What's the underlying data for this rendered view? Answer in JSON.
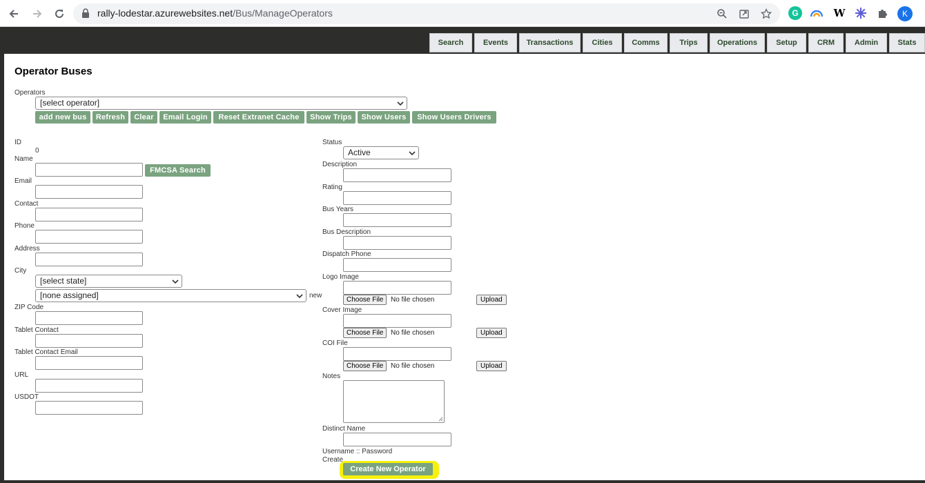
{
  "browser": {
    "url_host": "rally-lodestar.azurewebsites.net",
    "url_path": "/Bus/ManageOperators",
    "extensions": [
      "grammarly-icon",
      "arc-icon",
      "wikipedia-icon",
      "sparkle-icon",
      "puzzle-icon"
    ],
    "wikipedia_label": "W",
    "avatar_initial": "K"
  },
  "tabs": [
    "Search",
    "Events",
    "Transactions",
    "Cities",
    "Comms",
    "Trips",
    "Operations",
    "Setup",
    "CRM",
    "Admin",
    "Stats"
  ],
  "page": {
    "title": "Operator Buses",
    "operators_label": "Operators",
    "operator_select": "[select operator]",
    "actions": [
      "add new bus",
      "Refresh",
      "Clear",
      "Email Login",
      "Reset Extranet Cache",
      "Show Trips",
      "Show Users",
      "Show Users Drivers"
    ]
  },
  "left": {
    "id_label": "ID",
    "id_value": "0",
    "name_label": "Name",
    "fmcsa_button": "FMCSA Search",
    "email_label": "Email",
    "contact_label": "Contact",
    "phone_label": "Phone",
    "address_label": "Address",
    "city_label": "City",
    "state_select": "[select state]",
    "city_select": "[none assigned]",
    "city_new": "new",
    "zip_label": "ZIP Code",
    "tablet_contact_label": "Tablet Contact",
    "tablet_contact_email_label": "Tablet Contact Email",
    "url_label": "URL",
    "usdot_label": "USDOT"
  },
  "right": {
    "status_label": "Status",
    "status_select": "Active",
    "description_label": "Description",
    "rating_label": "Rating",
    "bus_years_label": "Bus Years",
    "bus_description_label": "Bus Description",
    "dispatch_phone_label": "Dispatch Phone",
    "logo_image_label": "Logo Image",
    "cover_image_label": "Cover Image",
    "coi_file_label": "COI File",
    "choose_file": "Choose File",
    "no_file": "No file chosen",
    "upload": "Upload",
    "notes_label": "Notes",
    "distinct_name_label": "Distinct Name",
    "username_password": "Username :: Password",
    "create_label": "Create",
    "create_button": "Create New Operator"
  },
  "colors": {
    "action_button": "#7aa37f",
    "highlight": "#f6f10c",
    "top_band": "#2d2d2b"
  }
}
